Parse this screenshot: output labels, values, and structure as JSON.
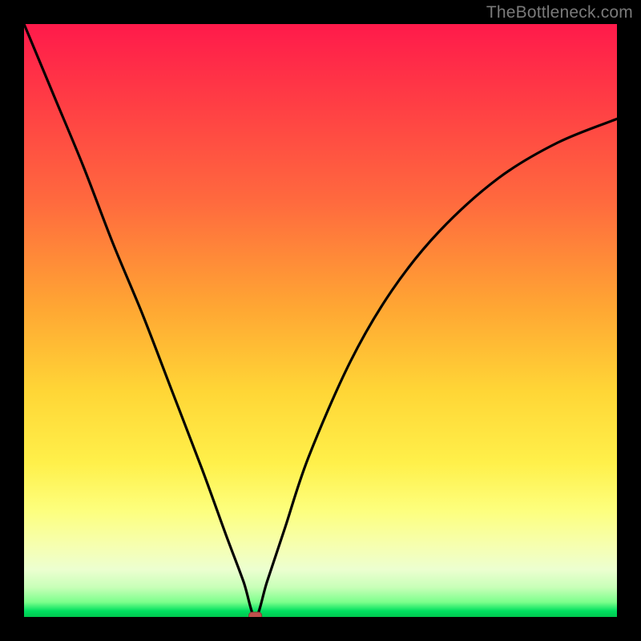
{
  "watermark": "TheBottleneck.com",
  "colors": {
    "frame_bg": "#000000",
    "gradient_top": "#ff1a4b",
    "gradient_mid": "#ffd636",
    "gradient_bottom": "#00c74f",
    "curve_stroke": "#000000",
    "marker_fill": "#c0504d"
  },
  "chart_data": {
    "type": "line",
    "title": "",
    "xlabel": "",
    "ylabel": "",
    "xlim": [
      0,
      100
    ],
    "ylim": [
      0,
      100
    ],
    "grid": false,
    "legend": false,
    "note": "V-shaped bottleneck curve; value estimated from pixel height (0 = bottom/green, 100 = top/red). Minimum ≈ 0 near x ≈ 39.",
    "series": [
      {
        "name": "bottleneck-curve",
        "x": [
          0,
          5,
          10,
          15,
          20,
          25,
          30,
          34,
          37,
          39,
          41,
          44,
          48,
          55,
          62,
          70,
          80,
          90,
          100
        ],
        "values": [
          100,
          88,
          76,
          63,
          51,
          38,
          25,
          14,
          6,
          0,
          6,
          15,
          27,
          43,
          55,
          65,
          74,
          80,
          84
        ]
      }
    ],
    "marker": {
      "x": 39,
      "y": 0,
      "shape": "rounded-rect",
      "color": "#c0504d"
    }
  }
}
